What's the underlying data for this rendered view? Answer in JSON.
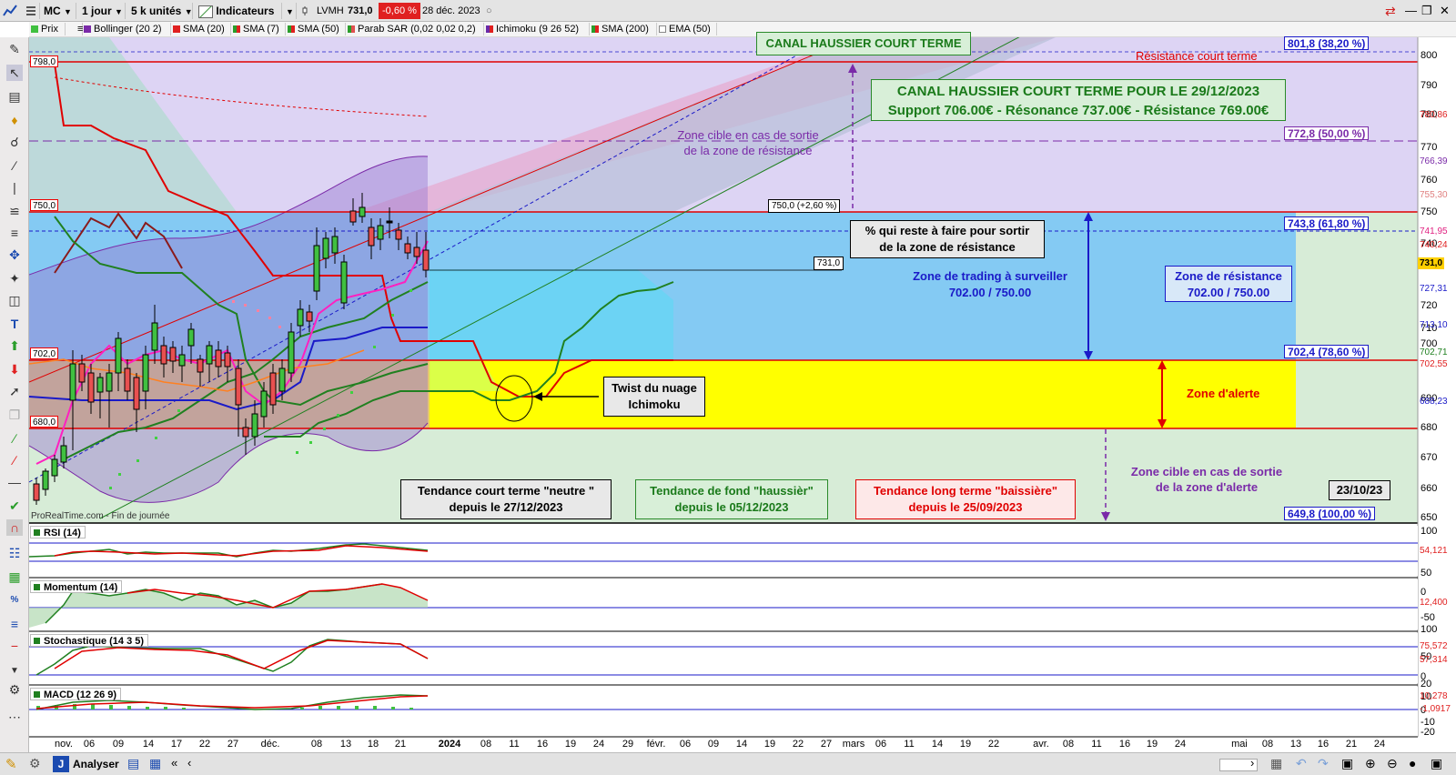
{
  "toolbar": {
    "symbol": "MC",
    "period": "1 jour",
    "units": "5 k unités",
    "indicators": "Indicateurs",
    "ticker": "LVMH",
    "price": "731,0",
    "change": "-0,60 %",
    "date": "28 déc. 2023"
  },
  "legend": [
    {
      "label": "Prix",
      "color": "#2a9d2a"
    },
    {
      "label": "Bollinger (20 2)",
      "color": "#7a2aa8"
    },
    {
      "label": "SMA (20)",
      "color": "#e02020"
    },
    {
      "label": "SMA (7)",
      "color": "#e02020"
    },
    {
      "label": "SMA (50)",
      "color": "#e02020"
    },
    {
      "label": "Parab SAR (0,02 0,02 0,2)",
      "color": "#e05050"
    },
    {
      "label": "Ichimoku (9 26 52)",
      "color": "#6a2aa8"
    },
    {
      "label": "SMA (200)",
      "color": "#e02020"
    },
    {
      "label": "EMA (50)",
      "color": "#ffffff"
    }
  ],
  "chart": {
    "y_ticks": [
      "800",
      "790",
      "780",
      "770",
      "760",
      "750",
      "740",
      "720",
      "710",
      "700",
      "690",
      "680",
      "670",
      "660",
      "650"
    ],
    "x_ticks": [
      "nov.",
      "06",
      "09",
      "14",
      "17",
      "22",
      "27",
      "déc.",
      "08",
      "13",
      "18",
      "21",
      "2024",
      "08",
      "11",
      "16",
      "19",
      "24",
      "29",
      "févr.",
      "06",
      "09",
      "14",
      "19",
      "22",
      "27",
      "mars",
      "06",
      "11",
      "14",
      "19",
      "22",
      "avr.",
      "08",
      "11",
      "16",
      "19",
      "24",
      "mai",
      "08",
      "13",
      "16",
      "21",
      "24"
    ],
    "left_levels": [
      "798,0",
      "750,0",
      "702,0",
      "680,0"
    ],
    "price_levels": [
      "801,8 (38,20 %)",
      "772,8 (50,00 %)",
      "743,8 (61,80 %)",
      "702,4 (78,60 %)",
      "649,8 (100,00 %)"
    ],
    "right_tags": [
      {
        "text": "780,86",
        "color": "#e02020"
      },
      {
        "text": "766,39",
        "color": "#7a2aa8"
      },
      {
        "text": "755,30",
        "color": "#e08080"
      },
      {
        "text": "741,95",
        "color": "#e02080"
      },
      {
        "text": "740,24",
        "color": "#e02020"
      },
      {
        "text": "731,0",
        "color": "#000000"
      },
      {
        "text": "727,31",
        "color": "#1a1ac8"
      },
      {
        "text": "713,10",
        "color": "#1a1ac8"
      },
      {
        "text": "702,71",
        "color": "#208020"
      },
      {
        "text": "702,55",
        "color": "#e02020"
      },
      {
        "text": "688,23",
        "color": "#1a1ac8"
      }
    ],
    "watermark": "ProRealTime.com - Fin de journée",
    "last_price_box": "731,0",
    "target_box": "750,0 (+2,60 %)"
  },
  "annotations": {
    "canal_title": "CANAL HAUSSIER COURT TERME",
    "resistance_ct": "Résistance court terme",
    "canal_box_line1": "CANAL HAUSSIER COURT TERME POUR LE 29/12/2023",
    "canal_box_line2": "Support 706.00€ - Résonance 737.00€ - Résistance 769.00€",
    "zone_cible_res_1": "Zone cible en cas de sortie",
    "zone_cible_res_2": "de la zone de résistance",
    "pct_box_1": "% qui reste à faire pour sortir",
    "pct_box_2": "de la zone de résistance",
    "trading_zone_1": "Zone de trading à surveiller",
    "trading_zone_2": "702.00 / 750.00",
    "resistance_zone_1": "Zone de résistance",
    "resistance_zone_2": "702.00 / 750.00",
    "twist_1": "Twist du nuage",
    "twist_2": "Ichimoku",
    "alert_zone": "Zone d'alerte",
    "zone_cible_alert_1": "Zone cible en cas de sortie",
    "zone_cible_alert_2": "de la zone d'alerte",
    "date_box": "23/10/23",
    "trend_short_1": "Tendance court terme \"neutre \"",
    "trend_short_2": "depuis le 27/12/2023",
    "trend_mid_1": "Tendance de fond \"haussièr\"",
    "trend_mid_2": "depuis le 05/12/2023",
    "trend_long_1": "Tendance long terme \"baissière\"",
    "trend_long_2": "depuis le 25/09/2023"
  },
  "panels": {
    "rsi": {
      "label": "RSI (14)",
      "ticks": [
        "100"
      ],
      "value": "54,121"
    },
    "momentum": {
      "label": "Momentum (14)",
      "ticks": [
        "50",
        "0",
        "-50"
      ],
      "value": "12,400"
    },
    "stochastic": {
      "label": "Stochastique (14 3 5)",
      "ticks": [
        "100",
        "50",
        "0"
      ],
      "values": [
        "75,572",
        "57,314"
      ]
    },
    "macd": {
      "label": "MACD (12 26 9)",
      "ticks": [
        "20",
        "10",
        "0",
        "-10",
        "-20"
      ],
      "values": [
        "10,278",
        "-1,0917"
      ]
    }
  },
  "bottombar": {
    "analyze": "Analyser"
  }
}
